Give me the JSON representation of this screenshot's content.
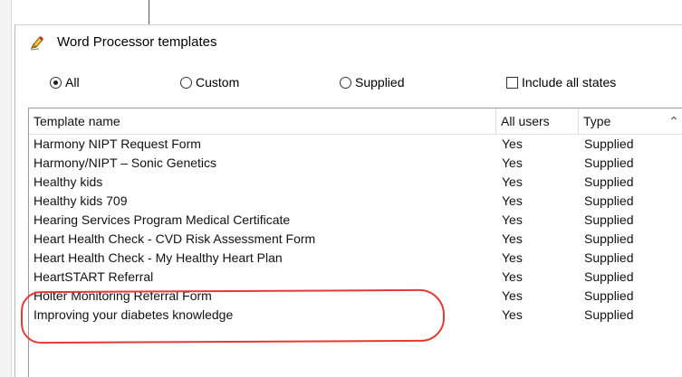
{
  "window": {
    "title": "Word Processor templates",
    "title_icon": "pencil-icon"
  },
  "filters": {
    "radio_all": "All",
    "radio_custom": "Custom",
    "radio_supplied": "Supplied",
    "selected": "All",
    "checkbox_label": "Include all states",
    "checkbox_checked": false
  },
  "table": {
    "headers": {
      "name": "Template name",
      "users": "All users",
      "type": "Type"
    },
    "rows": [
      {
        "name": "Harmony NIPT Request Form",
        "users": "Yes",
        "type": "Supplied"
      },
      {
        "name": "Harmony/NIPT – Sonic Genetics",
        "users": "Yes",
        "type": "Supplied"
      },
      {
        "name": "Healthy kids",
        "users": "Yes",
        "type": "Supplied"
      },
      {
        "name": "Healthy kids 709",
        "users": "Yes",
        "type": "Supplied"
      },
      {
        "name": "Hearing Services Program Medical Certificate",
        "users": "Yes",
        "type": "Supplied"
      },
      {
        "name": "Heart Health Check - CVD Risk Assessment Form",
        "users": "Yes",
        "type": "Supplied"
      },
      {
        "name": "Heart Health Check - My Healthy Heart Plan",
        "users": "Yes",
        "type": "Supplied"
      },
      {
        "name": "HeartSTART Referral",
        "users": "Yes",
        "type": "Supplied"
      },
      {
        "name": "Holter Monitoring Referral Form",
        "users": "Yes",
        "type": "Supplied"
      },
      {
        "name": "Improving your diabetes knowledge",
        "users": "Yes",
        "type": "Supplied"
      }
    ]
  },
  "annotation": {
    "highlight_color": "#e53935"
  }
}
